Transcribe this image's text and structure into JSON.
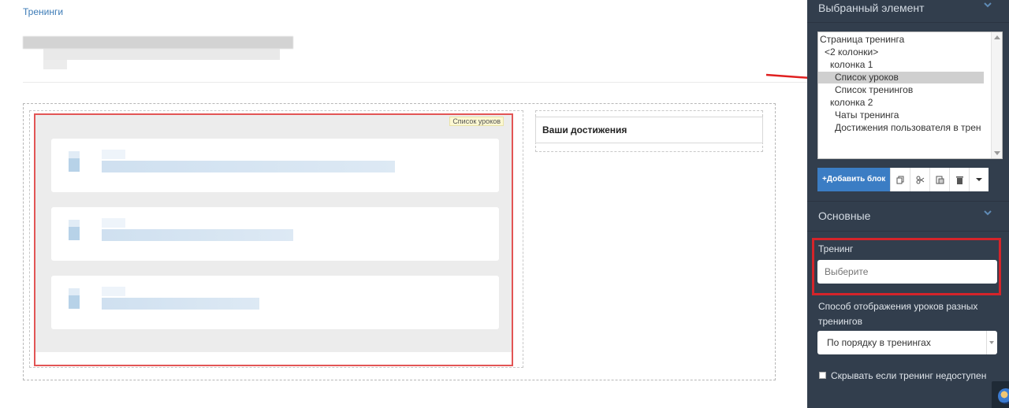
{
  "breadcrumb": "Тренинги",
  "blocks": {
    "lessons_tag": "Список уроков",
    "achievements_title": "Ваши достижения",
    "lesson_cards": [
      {
        "line_width_hint": "long"
      },
      {
        "line_width_hint": "medium"
      },
      {
        "line_width_hint": "short"
      }
    ]
  },
  "panel": {
    "selected_header": "Выбранный элемент",
    "tree": [
      {
        "label": "Страница тренинга",
        "selected": false
      },
      {
        "label": "<2 колонки>",
        "selected": false
      },
      {
        "label": "колонка 1",
        "selected": false
      },
      {
        "label": "Список уроков",
        "selected": true
      },
      {
        "label": "Список тренингов",
        "selected": false
      },
      {
        "label": "колонка 2",
        "selected": false
      },
      {
        "label": "Чаты тренинга",
        "selected": false
      },
      {
        "label": "Достижения пользователя в трен",
        "selected": false
      }
    ],
    "toolbar": {
      "add_block_label": "+Добавить блок",
      "icons": [
        "copy-icon",
        "cut-icon",
        "paste-icon",
        "trash-icon",
        "caret-down-icon"
      ]
    },
    "main_header": "Основные",
    "training_label": "Тренинг",
    "training_placeholder": "Выберите",
    "display_mode_label": "Способ отображения уроков разных тренингов",
    "display_mode_value": "По порядку в тренингах",
    "hide_checkbox_label": "Скрывать если тренинг недоступен",
    "hide_checkbox_checked": false
  },
  "colors": {
    "panel_bg": "#323e4d",
    "accent_blue": "#3b7dc4",
    "highlight_red": "#d5242a"
  }
}
